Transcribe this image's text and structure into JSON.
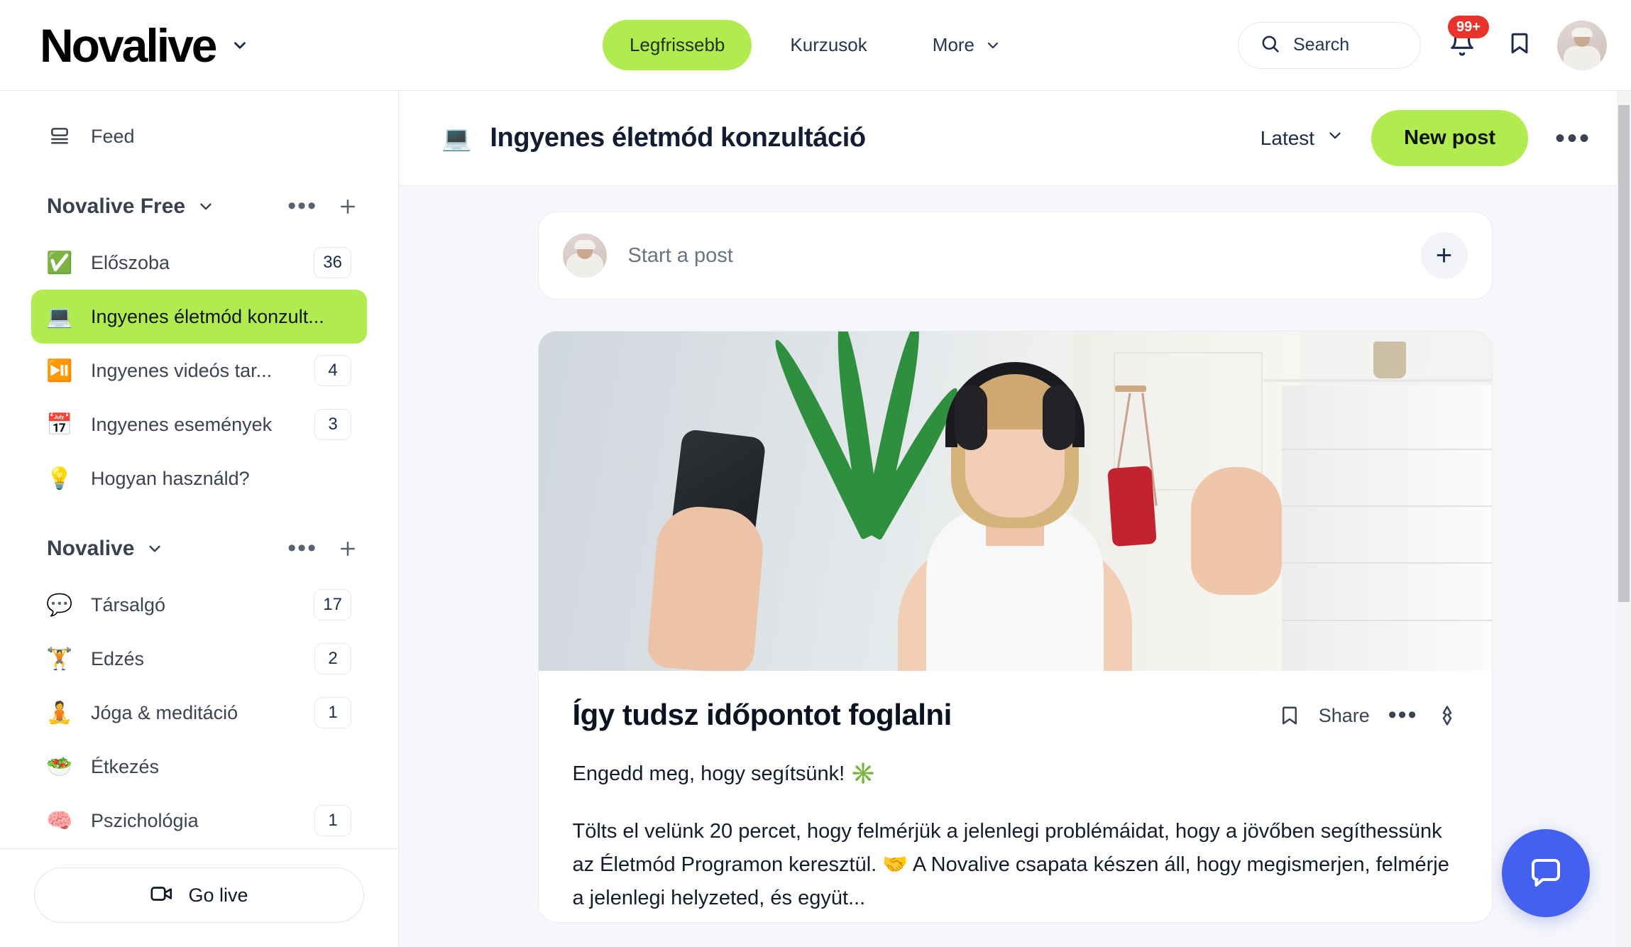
{
  "brand": {
    "name": "Novalive",
    "chevron_icon": "chevron-down-icon"
  },
  "topnav": {
    "items": [
      {
        "label": "Legfrissebb",
        "active": true
      },
      {
        "label": "Kurzusok",
        "active": false
      },
      {
        "label": "More",
        "active": false,
        "has_chevron": true
      }
    ]
  },
  "topright": {
    "search_placeholder": "Search",
    "search_icon": "search-icon",
    "notification_badge": "99+",
    "bell_icon": "bell-icon",
    "bookmark_icon": "bookmark-icon",
    "avatar_icon": "user-avatar"
  },
  "sidebar": {
    "feed": {
      "label": "Feed",
      "icon": "feed-icon"
    },
    "groups": [
      {
        "title": "Novalive Free",
        "chevron_icon": "chevron-down-icon",
        "more_icon": "more-horizontal-icon",
        "add_icon": "plus-icon",
        "items": [
          {
            "emoji": "✅",
            "label": "Előszoba",
            "count": "36",
            "active": false
          },
          {
            "emoji": "💻",
            "label": "Ingyenes életmód konzult...",
            "count": "",
            "active": true
          },
          {
            "emoji": "⏯️",
            "label": "Ingyenes videós tar...",
            "count": "4",
            "active": false
          },
          {
            "emoji": "📅",
            "label": "Ingyenes események",
            "count": "3",
            "active": false
          },
          {
            "emoji": "💡",
            "label": "Hogyan használd?",
            "count": "",
            "active": false
          }
        ]
      },
      {
        "title": "Novalive",
        "chevron_icon": "chevron-down-icon",
        "more_icon": "more-horizontal-icon",
        "add_icon": "plus-icon",
        "items": [
          {
            "emoji": "💬",
            "label": "Társalgó",
            "count": "17",
            "active": false
          },
          {
            "emoji": "🏋️",
            "label": "Edzés",
            "count": "2",
            "active": false
          },
          {
            "emoji": "🧘",
            "label": "Jóga & meditáció",
            "count": "1",
            "active": false
          },
          {
            "emoji": "🥗",
            "label": "Étkezés",
            "count": "",
            "active": false
          },
          {
            "emoji": "🧠",
            "label": "Pszichológia",
            "count": "1",
            "active": false
          }
        ]
      }
    ],
    "go_live": {
      "label": "Go live",
      "icon": "video-camera-icon"
    }
  },
  "main": {
    "channel_emoji": "💻",
    "channel_title": "Ingyenes életmód konzultáció",
    "sort_label": "Latest",
    "sort_chevron_icon": "chevron-down-icon",
    "new_post_label": "New post",
    "more_icon": "more-horizontal-icon",
    "composer": {
      "placeholder": "Start a post",
      "add_icon": "plus-icon",
      "avatar_icon": "user-avatar"
    },
    "post": {
      "image_alt": "Blonde woman wearing headphones waving at her smartphone during a video call",
      "title": "Így tudsz időpontot foglalni",
      "actions": {
        "bookmark_icon": "bookmark-icon",
        "share_label": "Share",
        "more_icon": "more-horizontal-icon",
        "pin_icon": "pin-icon"
      },
      "paragraphs": [
        "Engedd meg, hogy segítsünk! ✳️",
        "Tölts el velünk 20 percet, hogy felmérjük a jelenlegi problémáidat, hogy a jövőben segíthessünk az Életmód Programon keresztül. 🤝 A Novalive csapata készen áll, hogy megismerjen, felmérje a jelenlegi helyzeted, és együt..."
      ]
    },
    "chat_fab_icon": "chat-bubble-icon"
  },
  "colors": {
    "accent_lime": "#B0EC4F",
    "badge_red": "#E8342A",
    "fab_blue": "#4361EE",
    "text_navy": "#121C33",
    "page_bg": "#F6F7FB"
  }
}
